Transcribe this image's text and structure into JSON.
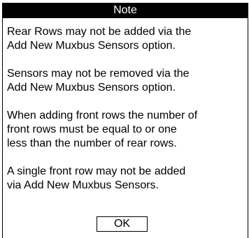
{
  "dialog": {
    "title": "Note",
    "paragraphs": [
      "Rear Rows may not be added via the\nAdd New Muxbus Sensors option.",
      "Sensors may not be removed via the\nAdd New Muxbus Sensors option.",
      "When adding front rows the number of\nfront rows must be equal to or one\nless than the number of rear rows.",
      "A single front row may not be added\nvia Add New Muxbus Sensors."
    ],
    "ok_label": "OK"
  },
  "colors": {
    "titlebar_bg": "#000000",
    "titlebar_text": "#ffffff",
    "background": "#ffffff",
    "border": "#000000"
  }
}
